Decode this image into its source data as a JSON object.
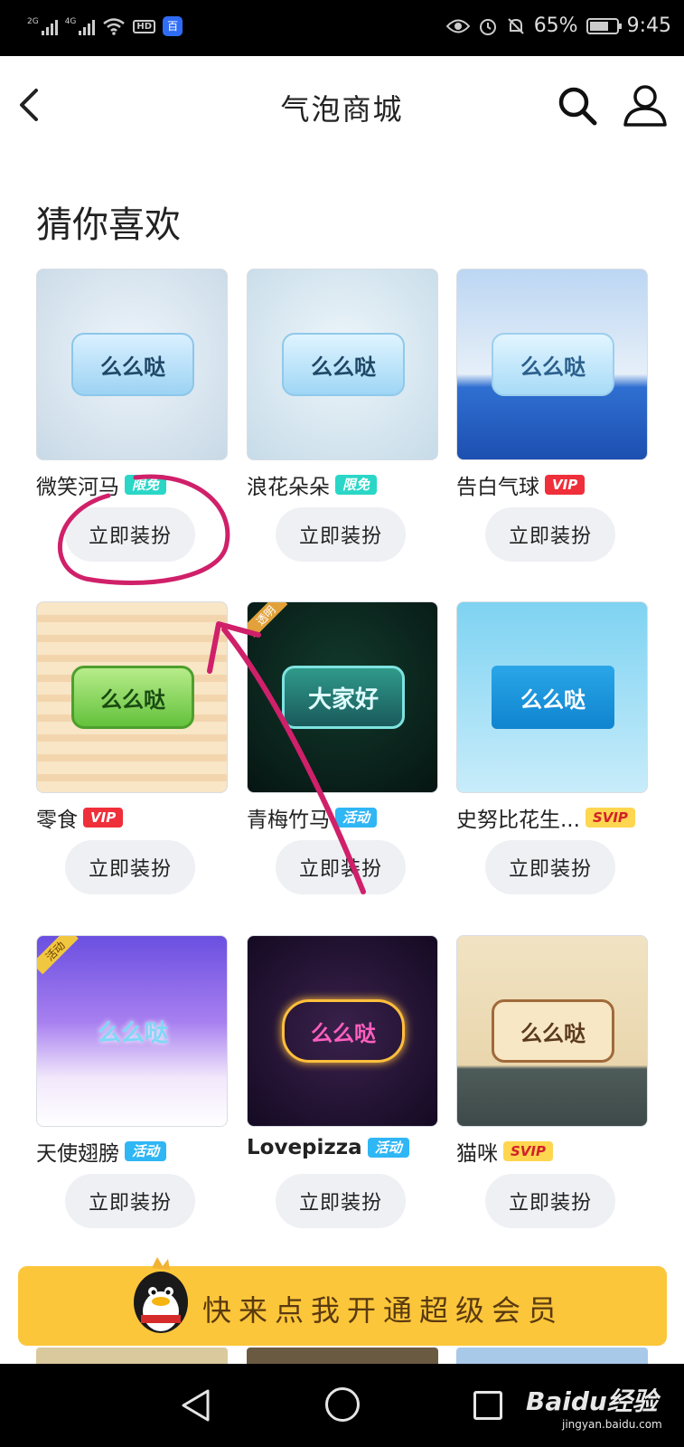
{
  "status_bar": {
    "sim1_label": "2G",
    "sim2_label": "4G",
    "hd_label": "HD",
    "baidu_app_label": "百",
    "battery_percent": "65%",
    "time": "9:45",
    "battery_level": 0.65
  },
  "header": {
    "title": "气泡商城",
    "icons": [
      "back-icon",
      "search-icon",
      "user-icon"
    ]
  },
  "section": {
    "title": "猜你喜欢"
  },
  "items": [
    {
      "name": "微笑河马",
      "badge": "限免",
      "badge_type": "free",
      "bubble_text": "么么哒",
      "button": "立即装扮"
    },
    {
      "name": "浪花朵朵",
      "badge": "限免",
      "badge_type": "free",
      "bubble_text": "么么哒",
      "button": "立即装扮"
    },
    {
      "name": "告白气球",
      "badge": "VIP",
      "badge_type": "vip",
      "bubble_text": "么么哒",
      "button": "立即装扮"
    },
    {
      "name": "零食",
      "badge": "VIP",
      "badge_type": "vip",
      "bubble_text": "么么哒",
      "button": "立即装扮"
    },
    {
      "name": "青梅竹马",
      "badge": "活动",
      "badge_type": "event",
      "bubble_text": "大家好",
      "corner_tag": "透明",
      "button": "立即装扮"
    },
    {
      "name": "史努比花生...",
      "badge": "SVIP",
      "badge_type": "svip",
      "bubble_text": "么么哒",
      "button": "立即装扮"
    },
    {
      "name": "天使翅膀",
      "badge": "活动",
      "badge_type": "event",
      "bubble_text": "么么哒",
      "corner_tag": "活动",
      "button": "立即装扮"
    },
    {
      "name": "Lovepizza",
      "badge": "活动",
      "badge_type": "event",
      "bubble_text": "么么哒",
      "button": "立即装扮"
    },
    {
      "name": "猫咪",
      "badge": "SVIP",
      "badge_type": "svip",
      "bubble_text": "么么哒",
      "button": "立即装扮"
    }
  ],
  "promo": {
    "text": "快来点我开通超级会员"
  },
  "nav_bar": {
    "icons": [
      "nav-back-icon",
      "nav-home-icon",
      "nav-recents-icon"
    ]
  },
  "watermark": {
    "main": "Baidu经验",
    "sub": "jingyan.baidu.com"
  },
  "colors": {
    "vip": "#ef2f3a",
    "free": "#2ad7c7",
    "event": "#2fb6f5",
    "svip": "#ffd64f",
    "promo": "#fcc63a",
    "annotation": "#d0206a"
  }
}
